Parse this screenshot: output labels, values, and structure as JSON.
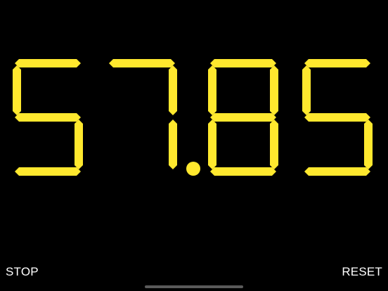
{
  "timer": {
    "value": "57.85",
    "segment_color": "#FFE82E"
  },
  "controls": {
    "stop_label": "STOP",
    "reset_label": "RESET"
  }
}
